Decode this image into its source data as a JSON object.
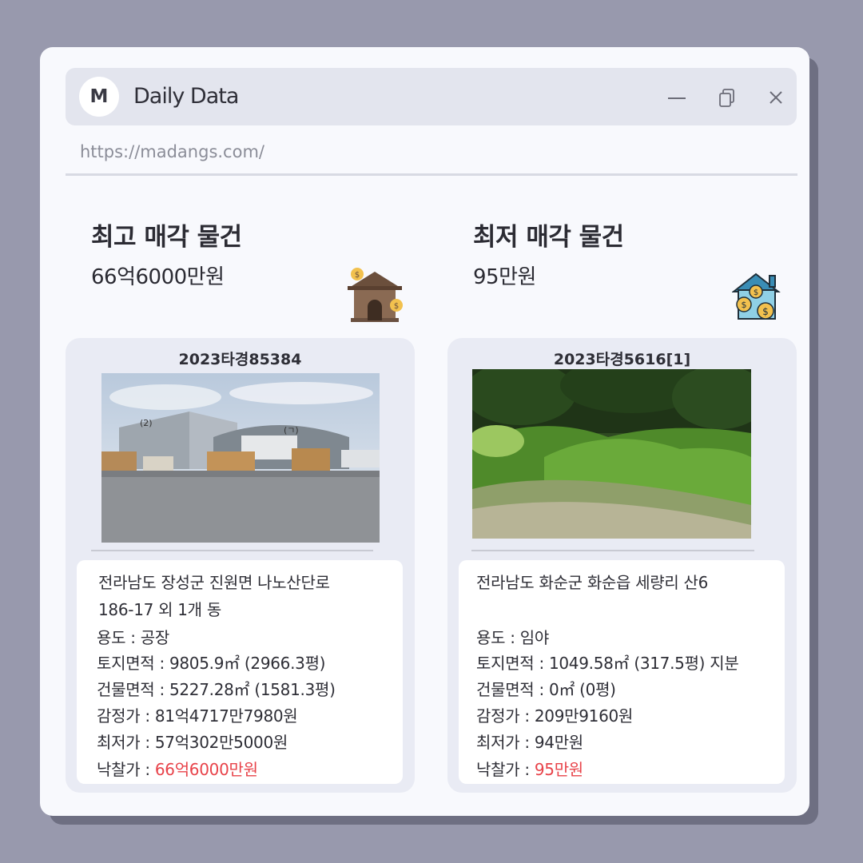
{
  "window": {
    "logo_letter": "M",
    "title": "Daily Data",
    "url": "https://madangs.com/",
    "icons": {
      "minimize": "minimize-icon",
      "restore": "restore-icon",
      "close": "close-icon"
    }
  },
  "highest": {
    "heading": "최고 매각 물건",
    "amount": "66억6000만원",
    "case_no": "2023타경85384",
    "address_line1": "전라남도 장성군 진원면 나노산단로",
    "address_line2": "186-17 외 1개 동",
    "usage": "용도 : 공장",
    "land_area": "토지면적 : 9805.9㎡ (2966.3평)",
    "building_area": "건물면적 : 5227.28㎡ (1581.3평)",
    "appraisal": "감정가 : 81억4717만7980원",
    "minimum": "최저가 : 57억302만5000원",
    "winning_label": "낙찰가 : ",
    "winning_value": "66억6000만원"
  },
  "lowest": {
    "heading": "최저 매각 물건",
    "amount": "95만원",
    "case_no": "2023타경5616[1]",
    "address_line1": "전라남도 화순군 화순읍 세량리 산6",
    "address_line2": "",
    "usage": "용도 : 임야",
    "land_area": "토지면적 : 1049.58㎡ (317.5평) 지분",
    "building_area": "건물면적 : 0㎡ (0평)",
    "appraisal": "감정가 : 209만9160원",
    "minimum": "최저가 : 94만원",
    "winning_label": "낙찰가 : ",
    "winning_value": "95만원"
  },
  "photo_labels": {
    "left_building": "(2)",
    "right_building": "(ㄱ)"
  },
  "colors": {
    "accent_red": "#e8434a",
    "background": "#9899ad",
    "card": "#e9ebf4"
  }
}
